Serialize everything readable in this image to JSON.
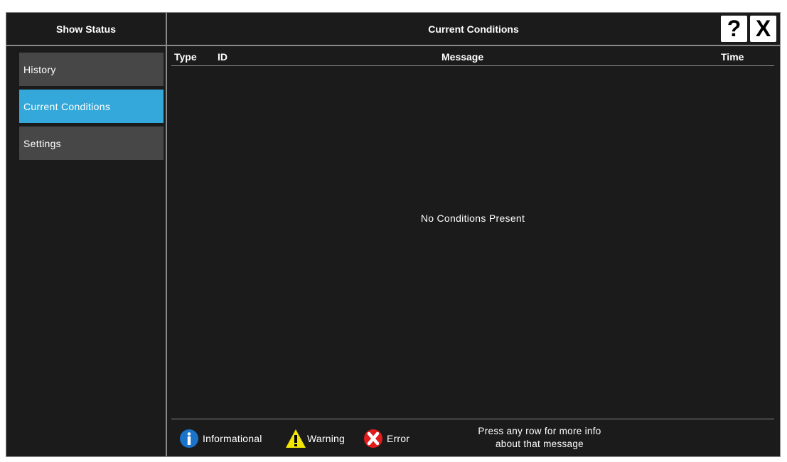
{
  "left_panel": {
    "title": "Show Status",
    "items": [
      {
        "label": "History",
        "selected": false
      },
      {
        "label": "Current Conditions",
        "selected": true
      },
      {
        "label": "Settings",
        "selected": false
      }
    ]
  },
  "main": {
    "title": "Current Conditions",
    "help_label": "?",
    "close_label": "X",
    "columns": [
      "Type",
      "ID",
      "Message",
      "Time"
    ],
    "empty_message": "No Conditions Present"
  },
  "legend": [
    {
      "icon": "info-icon",
      "label": "Informational",
      "color": "#1a73c8"
    },
    {
      "icon": "warning-icon",
      "label": "Warning",
      "color": "#f2e600"
    },
    {
      "icon": "error-icon",
      "label": "Error",
      "color": "#e01c1c"
    }
  ],
  "hint": {
    "line1": "Press any row for more info",
    "line2": "about that message"
  },
  "colors": {
    "background": "#1b1b1b",
    "selected": "#34a8da",
    "nav_item": "#474747",
    "border": "#8a8a8a"
  }
}
